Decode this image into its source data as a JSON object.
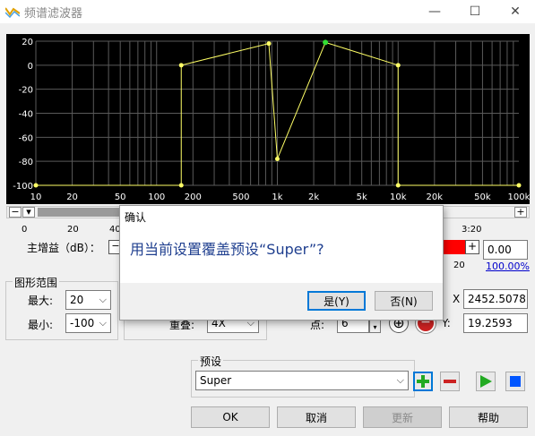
{
  "window": {
    "title": "频谱滤波器",
    "minimize": "—",
    "maximize": "☐",
    "close": "✕"
  },
  "chart_data": {
    "type": "line",
    "x_scale": "log",
    "xlim": [
      10,
      100000
    ],
    "ylim": [
      -100,
      20
    ],
    "y_ticks": [
      "20",
      "0",
      "-20",
      "-40",
      "-60",
      "-80",
      "-100"
    ],
    "x_ticks": [
      "10",
      "20",
      "50",
      "100",
      "200",
      "500",
      "1k",
      "2k",
      "5k",
      "10k",
      "20k",
      "50k",
      "100k"
    ],
    "grid": true,
    "series": [
      {
        "x": [
          10,
          160,
          160,
          850,
          1000,
          2500,
          10000,
          10000,
          100000
        ],
        "y": [
          -100,
          -100,
          0,
          18,
          -78,
          19,
          0,
          -100,
          -100
        ]
      }
    ],
    "highlight_point": {
      "x": 2500,
      "y": 19
    },
    "colors": {
      "background": "#000000",
      "grid": "#5a5a5a",
      "line": "#ffff66",
      "axis_text": "#ffffff",
      "highlight": "#33dd33"
    }
  },
  "timeline": {
    "labels": [
      "0",
      "20",
      "40",
      "3:20"
    ],
    "plus": "+"
  },
  "gain": {
    "label": "主增益（dB）：",
    "value": "0.00",
    "percent": "100.00%",
    "scale_label": "20",
    "plus": "+"
  },
  "range_group": {
    "title": "图形范围",
    "max_label": "最大:",
    "max_value": "20",
    "min_label": "最小:",
    "min_value": "-100"
  },
  "overlap": {
    "label": "重叠:",
    "value": "4X"
  },
  "points": {
    "label": "点:",
    "value": "6"
  },
  "coords": {
    "x_label": "X",
    "x_value": "2452.5078",
    "y_label": "Y:",
    "y_value": "19.2593"
  },
  "preset": {
    "title": "预设",
    "value": "Super"
  },
  "footer": {
    "ok": "OK",
    "cancel": "取消",
    "update": "更新",
    "help": "帮助"
  },
  "dialog": {
    "title": "确认",
    "message": "用当前设置覆盖预设“Super”?",
    "yes": "是(Y)",
    "no": "否(N)"
  },
  "colors": {
    "gain_slider": "#ff0000",
    "link": "#0000cc",
    "play": "#22aa22",
    "stop": "#0055ff",
    "add": "#22aa22",
    "remove": "#cc2222"
  }
}
